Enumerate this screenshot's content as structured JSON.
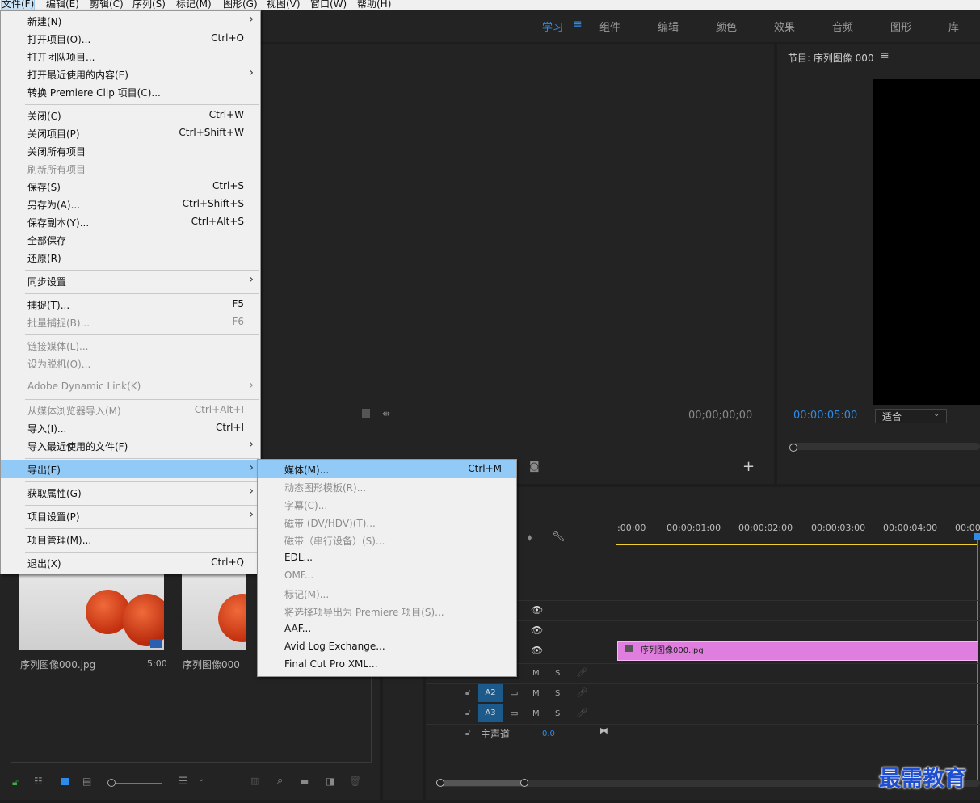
{
  "menubar": {
    "items": [
      "文件(F)",
      "编辑(E)",
      "剪辑(C)",
      "序列(S)",
      "标记(M)",
      "图形(G)",
      "视图(V)",
      "窗口(W)",
      "帮助(H)"
    ]
  },
  "workspaces": [
    "学习",
    "组件",
    "编辑",
    "颜色",
    "效果",
    "音频",
    "图形",
    "库"
  ],
  "source_monitor": {
    "timecode": "00;00;00;00"
  },
  "program_monitor": {
    "title": "节目: 序列图像 000",
    "timecode": "00:00:05:00",
    "zoom": "适合"
  },
  "project": {
    "items": [
      {
        "name": "序列图像000.jpg",
        "duration": "5:00"
      },
      {
        "name": "序列图像000",
        "duration": ""
      }
    ]
  },
  "timeline": {
    "ruler": [
      ":00:00",
      "00:00:01:00",
      "00:00:02:00",
      "00:00:03:00",
      "00:00:04:00",
      "00:00"
    ],
    "clip_name": "序列图像000.jpg",
    "audio_tracks": [
      "A2",
      "A3"
    ],
    "master_label": "主声道",
    "master_value": "0.0",
    "track_m": "M",
    "track_s": "S"
  },
  "file_menu": {
    "items": [
      {
        "label": "新建(N)",
        "shortcut": "",
        "submenu": true,
        "disabled": false
      },
      {
        "label": "打开项目(O)...",
        "shortcut": "Ctrl+O",
        "submenu": false,
        "disabled": false
      },
      {
        "label": "打开团队项目...",
        "shortcut": "",
        "submenu": false,
        "disabled": false
      },
      {
        "label": "打开最近使用的内容(E)",
        "shortcut": "",
        "submenu": true,
        "disabled": false
      },
      {
        "label": "转换 Premiere Clip 项目(C)...",
        "shortcut": "",
        "submenu": false,
        "disabled": false
      },
      {
        "label": "关闭(C)",
        "shortcut": "Ctrl+W",
        "submenu": false,
        "disabled": false
      },
      {
        "label": "关闭项目(P)",
        "shortcut": "Ctrl+Shift+W",
        "submenu": false,
        "disabled": false
      },
      {
        "label": "关闭所有项目",
        "shortcut": "",
        "submenu": false,
        "disabled": false
      },
      {
        "label": "刷新所有项目",
        "shortcut": "",
        "submenu": false,
        "disabled": true
      },
      {
        "label": "保存(S)",
        "shortcut": "Ctrl+S",
        "submenu": false,
        "disabled": false
      },
      {
        "label": "另存为(A)...",
        "shortcut": "Ctrl+Shift+S",
        "submenu": false,
        "disabled": false
      },
      {
        "label": "保存副本(Y)...",
        "shortcut": "Ctrl+Alt+S",
        "submenu": false,
        "disabled": false
      },
      {
        "label": "全部保存",
        "shortcut": "",
        "submenu": false,
        "disabled": false
      },
      {
        "label": "还原(R)",
        "shortcut": "",
        "submenu": false,
        "disabled": false
      },
      {
        "label": "同步设置",
        "shortcut": "",
        "submenu": true,
        "disabled": false
      },
      {
        "label": "捕捉(T)...",
        "shortcut": "F5",
        "submenu": false,
        "disabled": false
      },
      {
        "label": "批量捕捉(B)...",
        "shortcut": "F6",
        "submenu": false,
        "disabled": true
      },
      {
        "label": "链接媒体(L)...",
        "shortcut": "",
        "submenu": false,
        "disabled": true
      },
      {
        "label": "设为脱机(O)...",
        "shortcut": "",
        "submenu": false,
        "disabled": true
      },
      {
        "label": "Adobe Dynamic Link(K)",
        "shortcut": "",
        "submenu": true,
        "disabled": true
      },
      {
        "label": "从媒体浏览器导入(M)",
        "shortcut": "Ctrl+Alt+I",
        "submenu": false,
        "disabled": true
      },
      {
        "label": "导入(I)...",
        "shortcut": "Ctrl+I",
        "submenu": false,
        "disabled": false
      },
      {
        "label": "导入最近使用的文件(F)",
        "shortcut": "",
        "submenu": true,
        "disabled": false
      },
      {
        "label": "导出(E)",
        "shortcut": "",
        "submenu": true,
        "disabled": false
      },
      {
        "label": "获取属性(G)",
        "shortcut": "",
        "submenu": true,
        "disabled": false
      },
      {
        "label": "项目设置(P)",
        "shortcut": "",
        "submenu": true,
        "disabled": false
      },
      {
        "label": "项目管理(M)...",
        "shortcut": "",
        "submenu": false,
        "disabled": false
      },
      {
        "label": "退出(X)",
        "shortcut": "Ctrl+Q",
        "submenu": false,
        "disabled": false
      }
    ]
  },
  "export_submenu": {
    "items": [
      {
        "label": "媒体(M)...",
        "shortcut": "Ctrl+M",
        "disabled": false
      },
      {
        "label": "动态图形模板(R)...",
        "shortcut": "",
        "disabled": true
      },
      {
        "label": "字幕(C)...",
        "shortcut": "",
        "disabled": true
      },
      {
        "label": "磁带 (DV/HDV)(T)...",
        "shortcut": "",
        "disabled": true
      },
      {
        "label": "磁带（串行设备）(S)...",
        "shortcut": "",
        "disabled": true
      },
      {
        "label": "EDL...",
        "shortcut": "",
        "disabled": false
      },
      {
        "label": "OMF...",
        "shortcut": "",
        "disabled": true
      },
      {
        "label": "标记(M)...",
        "shortcut": "",
        "disabled": true
      },
      {
        "label": "将选择项导出为 Premiere 项目(S)...",
        "shortcut": "",
        "disabled": true
      },
      {
        "label": "AAF...",
        "shortcut": "",
        "disabled": false
      },
      {
        "label": "Avid Log Exchange...",
        "shortcut": "",
        "disabled": false
      },
      {
        "label": "Final Cut Pro XML...",
        "shortcut": "",
        "disabled": false
      }
    ]
  },
  "watermark": "最需教育",
  "colors": {
    "accent": "#2d8ceb",
    "clip": "#e07ee0",
    "highlight": "#91c9f7",
    "playhead": "#f0d030"
  }
}
